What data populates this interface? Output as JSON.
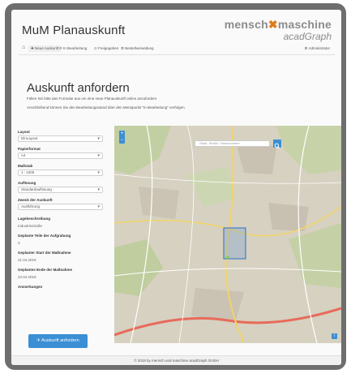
{
  "app": {
    "title": "MuM Planauskunft",
    "brand_main_a": "mensch",
    "brand_main_x": "✖",
    "brand_main_b": "maschine",
    "brand_sub": "acadGraph"
  },
  "nav": {
    "home_icon": "home-icon",
    "items": [
      {
        "label": "✚ Neue Auskunft"
      },
      {
        "label": "⟳ In Bearbeitung"
      },
      {
        "label": "⊙ Freigegeben"
      },
      {
        "label": "⚙ Bestellverwaltung"
      }
    ],
    "admin_label": "⚙ Administrator"
  },
  "page": {
    "heading": "Auskunft anfordern",
    "desc_line1": "Füllen Sie bitte das Formular aus um eine neue Planauskunft online anzufordern",
    "desc_line2": "Anschließend können Sie den Bearbeitungsstand über den Menüpunkt \"In Bearbeitung\" verfolgen."
  },
  "form": {
    "layout_label": "Layout",
    "layout_value": "DinLayout",
    "paper_label": "Papierformat",
    "paper_value": "A4",
    "scale_label": "Maßstab",
    "scale_value": "1 : 1000",
    "resolution_label": "Auflösung",
    "resolution_value": "Standardauflösung",
    "purpose_label": "Zweck der Auskunft",
    "purpose_value": "Ausführung",
    "location_label": "Lagebeschreibung",
    "location_value": "Industriestraße",
    "parts_label": "Geplante Teile der Aufgrabung",
    "parts_value": "3",
    "start_label": "Geplanter Start der Maßnahme",
    "start_value": "21.04.2018",
    "end_label": "Geplantes Ende der Maßnahme",
    "end_value": "22.04.2018",
    "notes_label": "Anmerkungen",
    "submit_label": "✈ Auskunft anfordern"
  },
  "map": {
    "search_placeholder": "Stadt, Straße, Hausnummer",
    "search_icon": "search-icon",
    "zoom_in": "+",
    "zoom_out": "−",
    "info_label": "i"
  },
  "footer": {
    "text": "© 2018 by mensch und maschine acadGraph GmbH"
  },
  "colors": {
    "accent": "#3b8fd4",
    "brand_orange": "#e07b1a",
    "frame": "#6e6e6e"
  }
}
